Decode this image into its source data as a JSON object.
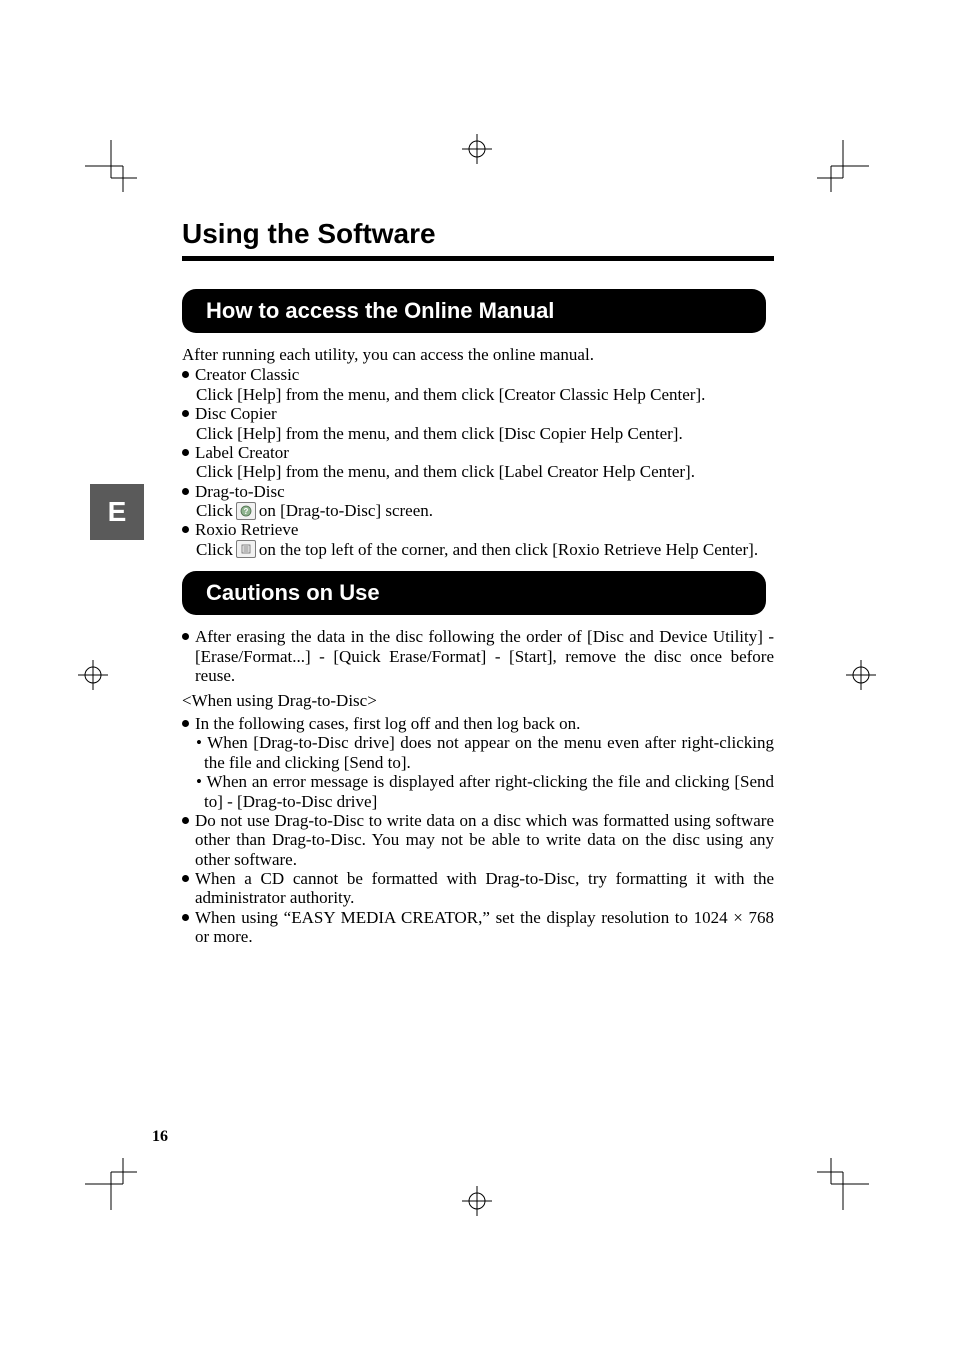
{
  "page_title": "Using the Software",
  "page_number": "16",
  "tab_letter": "E",
  "sections": {
    "online_manual": {
      "header": "How to access the Online Manual",
      "intro": "After running each utility, you can access the online manual.",
      "items": {
        "creator_classic": {
          "title": "Creator Classic",
          "desc": "Click [Help] from the menu, and them click [Creator Classic Help Center]."
        },
        "disc_copier": {
          "title": "Disc Copier",
          "desc": "Click [Help] from the menu, and them click [Disc Copier Help Center]."
        },
        "label_creator": {
          "title": "Label Creator",
          "desc": "Click [Help] from the menu, and them click [Label Creator Help Center]."
        },
        "drag_to_disc": {
          "title": "Drag-to-Disc",
          "click_prefix": "Click",
          "click_suffix": "on [Drag-to-Disc] screen."
        },
        "roxio_retrieve": {
          "title": "Roxio Retrieve",
          "click_prefix": "Click",
          "click_suffix": "on the top left of the corner, and then click [Roxio Retrieve Help Center]."
        }
      }
    },
    "cautions": {
      "header": "Cautions on Use",
      "erase_data": "After erasing the data in the disc following the order of [Disc and Device Utility] - [Erase/Format...] - [Quick Erase/Format] - [Start], remove the disc once before reuse.",
      "when_using_header": "<When using Drag-to-Disc>",
      "logoff_intro": "In the following cases, first log off and then log back on.",
      "logoff_case1": "• When [Drag-to-Disc drive] does not appear on the menu even after right-clicking the file and clicking [Send to].",
      "logoff_case2": "• When an error message is displayed after right-clicking the file and clicking [Send to] - [Drag-to-Disc drive]",
      "do_not_use": "Do not use Drag-to-Disc to write data on a disc which was formatted using software other than Drag-to-Disc. You may not be able to write data on the disc using any other software.",
      "cd_format": "When a CD cannot be formatted with Drag-to-Disc, try formatting it with the administrator authority.",
      "easy_media": "When using “EASY MEDIA CREATOR,” set the display resolution to 1024 × 768 or more."
    }
  }
}
